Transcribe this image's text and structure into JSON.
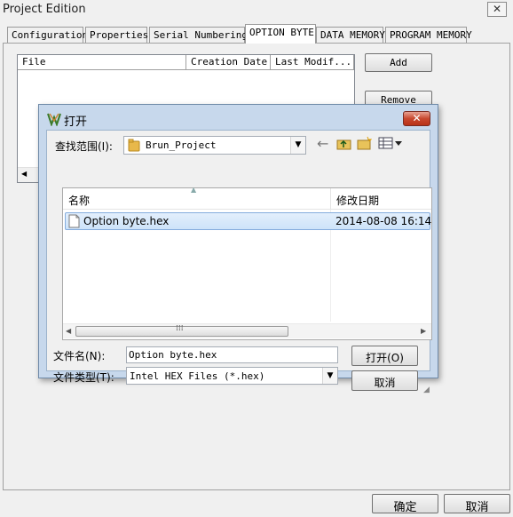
{
  "window": {
    "title": "Project Edition",
    "close_glyph": "✕"
  },
  "tabs": [
    {
      "label": "Configuration"
    },
    {
      "label": "Properties"
    },
    {
      "label": "Serial Numbering"
    },
    {
      "label": "OPTION BYTE",
      "active": true
    },
    {
      "label": "DATA MEMORY"
    },
    {
      "label": "PROGRAM MEMORY"
    }
  ],
  "file_list": {
    "columns": [
      "File",
      "Creation Date",
      "Last Modif..."
    ],
    "rows": []
  },
  "buttons": {
    "add": "Add",
    "remove": "Remove",
    "ok": "确定",
    "cancel": "取消"
  },
  "open_dialog": {
    "title": "打开",
    "look_in_label": "查找范围(I):",
    "look_in_value": "Brun_Project",
    "columns": {
      "name": "名称",
      "modified": "修改日期"
    },
    "files": [
      {
        "name": "Option byte.hex",
        "modified": "2014-08-08 16:14",
        "selected": true
      }
    ],
    "filename_label": "文件名(N):",
    "filename_value": "Option byte.hex",
    "filetype_label": "文件类型(T):",
    "filetype_value": "Intel HEX Files (*.hex)",
    "open_button": "打开(O)",
    "cancel_button": "取消"
  },
  "colors": {
    "dialog_frame": "#c7d8ec",
    "selection": "#cde3f9",
    "close_red": "#c8482f"
  }
}
